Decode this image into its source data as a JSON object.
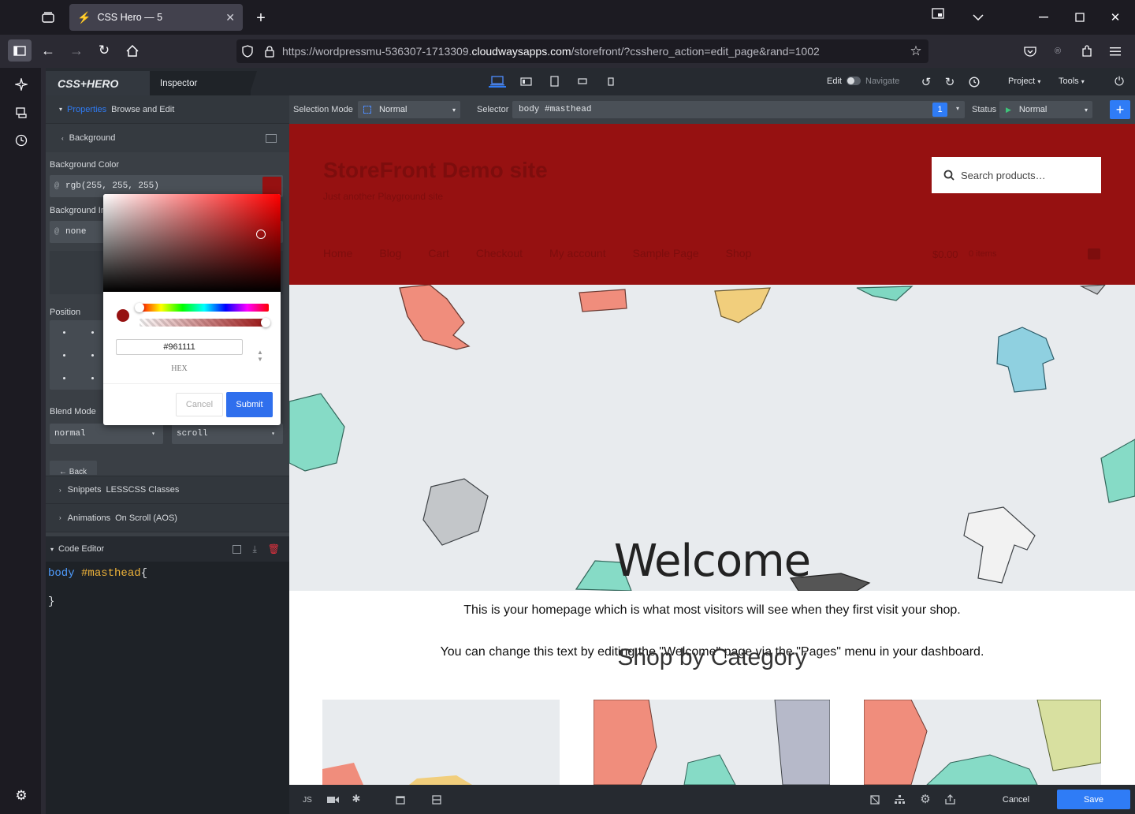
{
  "browser": {
    "tab_title": "CSS Hero — 5",
    "url_prefix": "https://wordpressmu-536307-1713309.",
    "url_domain": "cloudwaysapps.com",
    "url_suffix": "/storefront/?csshero_action=edit_page&rand=1002"
  },
  "hero": {
    "logo": "CSS+HERO",
    "inspector_tab": "Inspector",
    "edit_label": "Edit",
    "navigate_label": "Navigate",
    "project_menu": "Project",
    "tools_menu": "Tools",
    "properties_link": "Properties",
    "browse_edit": "Browse and Edit",
    "background_section": "Background",
    "background_color_label": "Background Color",
    "background_color_value": "rgb(255, 255, 255)",
    "background_image_label": "Background Im",
    "background_image_value": "none",
    "position_label": "Position",
    "blend_mode_label": "Blend Mode",
    "blend_mode_value": "normal",
    "attachment_value": "scroll",
    "back_label": "← Back",
    "snippets_label": "Snippets",
    "lesscss_label": "LESSCSS Classes",
    "animations_label": "Animations",
    "aos_label": "On Scroll (AOS)",
    "code_editor_label": "Code Editor",
    "code_line1_a": "body",
    "code_line1_b": "#masthead",
    "code_line1_c": "{",
    "code_line2": "}",
    "selection_mode_label": "Selection Mode",
    "selection_mode_value": "Normal",
    "selector_label": "Selector",
    "selector_value": "body #masthead",
    "selector_count": "1",
    "status_label": "Status",
    "status_value": "Normal",
    "cancel": "Cancel",
    "save": "Save",
    "js_label": "JS"
  },
  "picker": {
    "hex_value": "#961111",
    "mode_label": "HEX",
    "cancel": "Cancel",
    "submit": "Submit",
    "color": "#961111"
  },
  "site": {
    "title": "StoreFront Demo site",
    "tagline": "Just another Playground site",
    "search_placeholder": "Search products…",
    "nav": [
      "Home",
      "Blog",
      "Cart",
      "Checkout",
      "My account",
      "Sample Page",
      "Shop"
    ],
    "cart_total": "$0.00",
    "cart_items": "0 items",
    "welcome": "Welcome",
    "intro1": "This is your homepage which is what most visitors will see when they first visit your shop.",
    "intro2": "You can change this text by editing the \"Welcome\" page via the \"Pages\" menu in your dashboard.",
    "shop_by_category": "Shop by Category"
  }
}
